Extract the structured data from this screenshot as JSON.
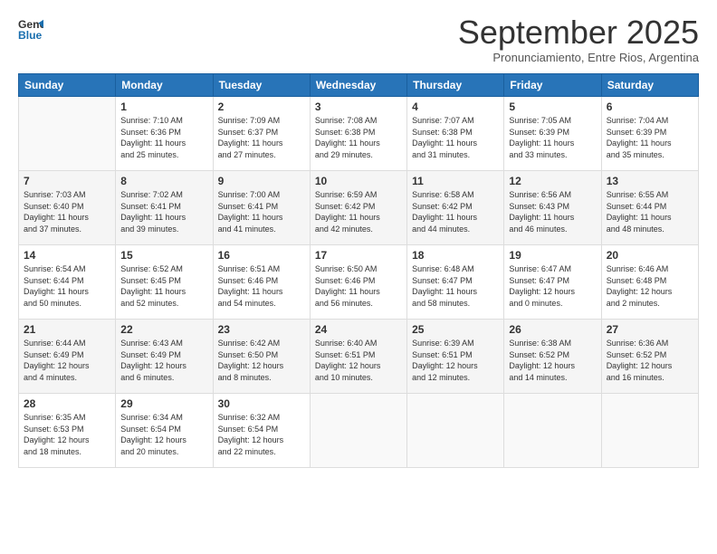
{
  "logo": {
    "line1": "General",
    "line2": "Blue"
  },
  "title": "September 2025",
  "subtitle": "Pronunciamiento, Entre Rios, Argentina",
  "weekdays": [
    "Sunday",
    "Monday",
    "Tuesday",
    "Wednesday",
    "Thursday",
    "Friday",
    "Saturday"
  ],
  "weeks": [
    [
      {
        "day": "",
        "info": ""
      },
      {
        "day": "1",
        "info": "Sunrise: 7:10 AM\nSunset: 6:36 PM\nDaylight: 11 hours\nand 25 minutes."
      },
      {
        "day": "2",
        "info": "Sunrise: 7:09 AM\nSunset: 6:37 PM\nDaylight: 11 hours\nand 27 minutes."
      },
      {
        "day": "3",
        "info": "Sunrise: 7:08 AM\nSunset: 6:38 PM\nDaylight: 11 hours\nand 29 minutes."
      },
      {
        "day": "4",
        "info": "Sunrise: 7:07 AM\nSunset: 6:38 PM\nDaylight: 11 hours\nand 31 minutes."
      },
      {
        "day": "5",
        "info": "Sunrise: 7:05 AM\nSunset: 6:39 PM\nDaylight: 11 hours\nand 33 minutes."
      },
      {
        "day": "6",
        "info": "Sunrise: 7:04 AM\nSunset: 6:39 PM\nDaylight: 11 hours\nand 35 minutes."
      }
    ],
    [
      {
        "day": "7",
        "info": "Sunrise: 7:03 AM\nSunset: 6:40 PM\nDaylight: 11 hours\nand 37 minutes."
      },
      {
        "day": "8",
        "info": "Sunrise: 7:02 AM\nSunset: 6:41 PM\nDaylight: 11 hours\nand 39 minutes."
      },
      {
        "day": "9",
        "info": "Sunrise: 7:00 AM\nSunset: 6:41 PM\nDaylight: 11 hours\nand 41 minutes."
      },
      {
        "day": "10",
        "info": "Sunrise: 6:59 AM\nSunset: 6:42 PM\nDaylight: 11 hours\nand 42 minutes."
      },
      {
        "day": "11",
        "info": "Sunrise: 6:58 AM\nSunset: 6:42 PM\nDaylight: 11 hours\nand 44 minutes."
      },
      {
        "day": "12",
        "info": "Sunrise: 6:56 AM\nSunset: 6:43 PM\nDaylight: 11 hours\nand 46 minutes."
      },
      {
        "day": "13",
        "info": "Sunrise: 6:55 AM\nSunset: 6:44 PM\nDaylight: 11 hours\nand 48 minutes."
      }
    ],
    [
      {
        "day": "14",
        "info": "Sunrise: 6:54 AM\nSunset: 6:44 PM\nDaylight: 11 hours\nand 50 minutes."
      },
      {
        "day": "15",
        "info": "Sunrise: 6:52 AM\nSunset: 6:45 PM\nDaylight: 11 hours\nand 52 minutes."
      },
      {
        "day": "16",
        "info": "Sunrise: 6:51 AM\nSunset: 6:46 PM\nDaylight: 11 hours\nand 54 minutes."
      },
      {
        "day": "17",
        "info": "Sunrise: 6:50 AM\nSunset: 6:46 PM\nDaylight: 11 hours\nand 56 minutes."
      },
      {
        "day": "18",
        "info": "Sunrise: 6:48 AM\nSunset: 6:47 PM\nDaylight: 11 hours\nand 58 minutes."
      },
      {
        "day": "19",
        "info": "Sunrise: 6:47 AM\nSunset: 6:47 PM\nDaylight: 12 hours\nand 0 minutes."
      },
      {
        "day": "20",
        "info": "Sunrise: 6:46 AM\nSunset: 6:48 PM\nDaylight: 12 hours\nand 2 minutes."
      }
    ],
    [
      {
        "day": "21",
        "info": "Sunrise: 6:44 AM\nSunset: 6:49 PM\nDaylight: 12 hours\nand 4 minutes."
      },
      {
        "day": "22",
        "info": "Sunrise: 6:43 AM\nSunset: 6:49 PM\nDaylight: 12 hours\nand 6 minutes."
      },
      {
        "day": "23",
        "info": "Sunrise: 6:42 AM\nSunset: 6:50 PM\nDaylight: 12 hours\nand 8 minutes."
      },
      {
        "day": "24",
        "info": "Sunrise: 6:40 AM\nSunset: 6:51 PM\nDaylight: 12 hours\nand 10 minutes."
      },
      {
        "day": "25",
        "info": "Sunrise: 6:39 AM\nSunset: 6:51 PM\nDaylight: 12 hours\nand 12 minutes."
      },
      {
        "day": "26",
        "info": "Sunrise: 6:38 AM\nSunset: 6:52 PM\nDaylight: 12 hours\nand 14 minutes."
      },
      {
        "day": "27",
        "info": "Sunrise: 6:36 AM\nSunset: 6:52 PM\nDaylight: 12 hours\nand 16 minutes."
      }
    ],
    [
      {
        "day": "28",
        "info": "Sunrise: 6:35 AM\nSunset: 6:53 PM\nDaylight: 12 hours\nand 18 minutes."
      },
      {
        "day": "29",
        "info": "Sunrise: 6:34 AM\nSunset: 6:54 PM\nDaylight: 12 hours\nand 20 minutes."
      },
      {
        "day": "30",
        "info": "Sunrise: 6:32 AM\nSunset: 6:54 PM\nDaylight: 12 hours\nand 22 minutes."
      },
      {
        "day": "",
        "info": ""
      },
      {
        "day": "",
        "info": ""
      },
      {
        "day": "",
        "info": ""
      },
      {
        "day": "",
        "info": ""
      }
    ]
  ]
}
